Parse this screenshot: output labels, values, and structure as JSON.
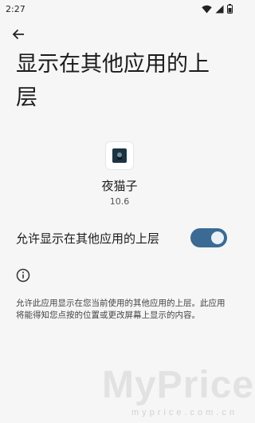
{
  "status_bar": {
    "time": "2:27",
    "icons": [
      "wifi-icon",
      "signal-icon",
      "battery-icon"
    ]
  },
  "header": {
    "back_icon": "arrow-back-icon",
    "title": "显示在其他应用的上层"
  },
  "app": {
    "name": "夜猫子",
    "version": "10.6"
  },
  "permission": {
    "label": "允许显示在其他应用的上层",
    "enabled": true
  },
  "info": {
    "icon": "info-icon",
    "description": "允许此应用显示在您当前使用的其他应用的上层。此应用将能得知您点按的位置或更改屏幕上显示的内容。"
  },
  "watermark": {
    "logo": "MyPrice",
    "url": "myprice.com.cn"
  },
  "colors": {
    "background": "#f6f6f6",
    "toggle_track": "#3b6a95",
    "toggle_thumb": "#eaf1f8"
  }
}
